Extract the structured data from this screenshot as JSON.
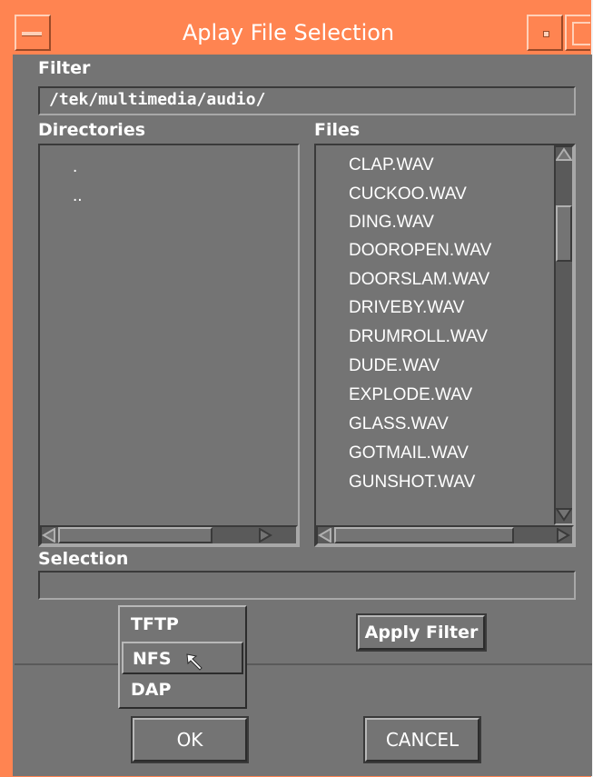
{
  "window": {
    "title": "Aplay File Selection"
  },
  "filter": {
    "label": "Filter",
    "value": "/tek/multimedia/audio/"
  },
  "directories": {
    "label": "Directories",
    "items": [
      ".",
      ".."
    ]
  },
  "files": {
    "label": "Files",
    "items": [
      "CLAP.WAV",
      "CUCKOO.WAV",
      "DING.WAV",
      "DOOROPEN.WAV",
      "DOORSLAM.WAV",
      "DRIVEBY.WAV",
      "DRUMROLL.WAV",
      "DUDE.WAV",
      "EXPLODE.WAV",
      "GLASS.WAV",
      "GOTMAIL.WAV",
      "GUNSHOT.WAV"
    ]
  },
  "selection": {
    "label": "Selection",
    "value": ""
  },
  "protocol_menu": {
    "options": [
      "TFTP",
      "NFS",
      "DAP"
    ],
    "highlighted": "NFS"
  },
  "buttons": {
    "apply_filter": "Apply Filter",
    "ok": "OK",
    "cancel": "CANCEL"
  },
  "colors": {
    "frame": "#ff8451",
    "dialog_bg": "#747474",
    "text": "#ffffff"
  }
}
